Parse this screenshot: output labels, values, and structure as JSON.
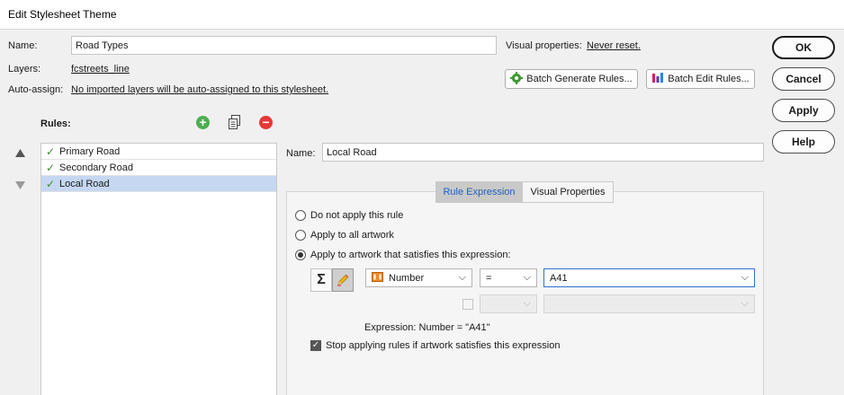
{
  "window": {
    "title": "Edit Stylesheet Theme"
  },
  "form": {
    "name_label": "Name:",
    "name_value": "Road Types",
    "layers_label": "Layers:",
    "layers_value": "fcstreets_line",
    "autoassign_label": "Auto-assign:",
    "autoassign_value": "No imported layers will be auto-assigned to this stylesheet.",
    "visual_props_label": "Visual properties:",
    "visual_props_value": "Never reset."
  },
  "toolbar": {
    "batch_generate_label": "Batch Generate Rules...",
    "batch_edit_label": "Batch Edit Rules..."
  },
  "side_buttons": {
    "ok": "OK",
    "cancel": "Cancel",
    "apply": "Apply",
    "help": "Help"
  },
  "rules": {
    "label": "Rules:",
    "items": [
      {
        "label": "Primary Road"
      },
      {
        "label": "Secondary Road"
      },
      {
        "label": "Local Road"
      }
    ],
    "selected_index": 2
  },
  "detail": {
    "name_label": "Name:",
    "name_value": "Local Road",
    "tabs": [
      {
        "label": "Rule Expression"
      },
      {
        "label": "Visual Properties"
      }
    ],
    "options": [
      {
        "label": "Do not apply this rule"
      },
      {
        "label": "Apply to all artwork"
      },
      {
        "label": "Apply to artwork that satisfies this expression:"
      }
    ],
    "selected_option": 2,
    "expression": {
      "attribute": "Number",
      "operator": "=",
      "value": "A41",
      "summary": "Expression: Number = \"A41\""
    },
    "stop_label": "Stop applying rules if artwork satisfies this expression",
    "stop_checked": true
  },
  "colors": {
    "selected_row": "#c5d7f1",
    "check_green": "#3a8a2c",
    "add_green": "#4caf50",
    "remove_red": "#e53935",
    "active_tab_text": "#1f5fbf"
  }
}
